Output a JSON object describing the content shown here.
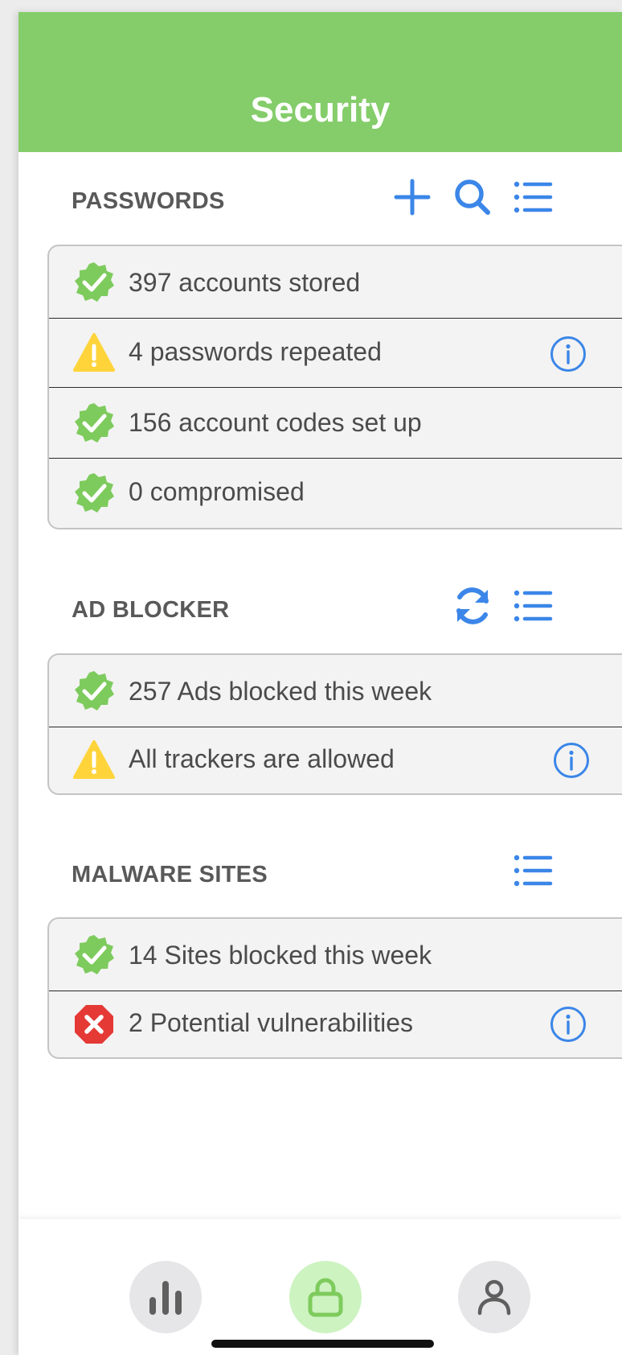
{
  "header": {
    "title": "Security",
    "color": "#84cd6a"
  },
  "accent_color": "#3b86e8",
  "status_colors": {
    "ok": "#7ecb5d",
    "warning": "#ffd43b",
    "error": "#e53935"
  },
  "sections": {
    "passwords": {
      "title": "PASSWORDS",
      "actions": [
        "plus-icon",
        "search-icon",
        "list-icon"
      ],
      "rows": [
        {
          "status": "ok",
          "icon": "check-badge-icon",
          "text": "397 accounts stored"
        },
        {
          "status": "warning",
          "icon": "warning-icon",
          "text": "4 passwords repeated",
          "info": "info-icon"
        },
        {
          "status": "ok",
          "icon": "check-badge-icon",
          "text": "156 account codes set up"
        },
        {
          "status": "ok",
          "icon": "check-badge-icon",
          "text": "0 compromised"
        }
      ]
    },
    "ad_blocker": {
      "title": "AD BLOCKER",
      "actions": [
        "refresh-icon",
        "list-icon"
      ],
      "rows": [
        {
          "status": "ok",
          "icon": "check-badge-icon",
          "text": "257 Ads blocked this week"
        },
        {
          "status": "warning",
          "icon": "warning-icon",
          "text": "All trackers are allowed",
          "info": "info-icon"
        }
      ]
    },
    "malware_sites": {
      "title": "MALWARE SITES",
      "actions": [
        "list-icon"
      ],
      "rows": [
        {
          "status": "ok",
          "icon": "check-badge-icon",
          "text": "14 Sites blocked this week"
        },
        {
          "status": "error",
          "icon": "error-octagon-icon",
          "text": "2 Potential vulnerabilities",
          "info": "info-icon"
        }
      ]
    }
  },
  "tabbar": {
    "tabs": [
      {
        "icon": "bar-chart-icon",
        "active": false
      },
      {
        "icon": "lock-icon",
        "active": true
      },
      {
        "icon": "user-icon",
        "active": false
      }
    ]
  }
}
